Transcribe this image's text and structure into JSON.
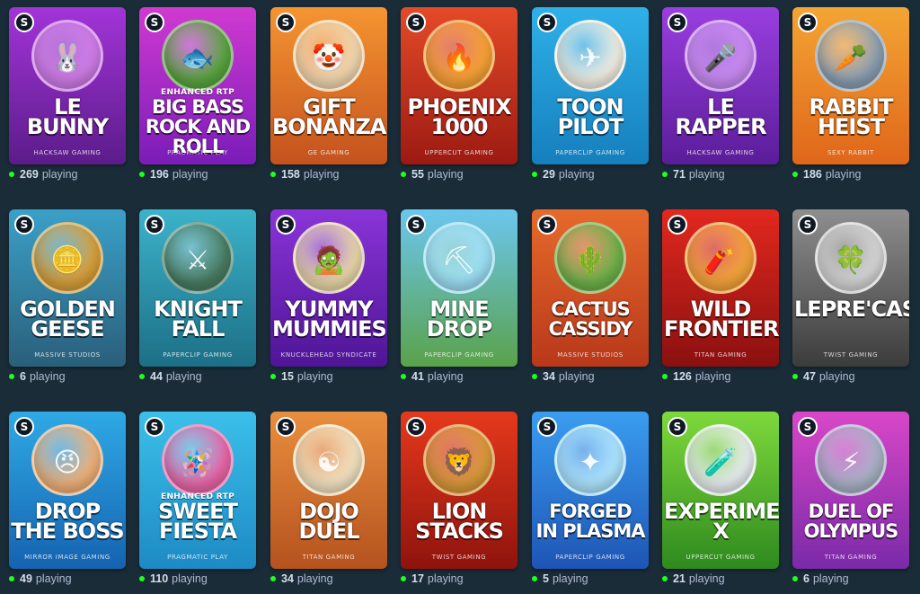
{
  "playing_label": "playing",
  "colors": {
    "background": "#1a2c38",
    "online_dot": "#1fff20"
  },
  "games": [
    {
      "title": "LE\nBUNNY",
      "subtitle": "",
      "provider": "HACKSAW GAMING",
      "players": "269",
      "bg": [
        "#a234d8",
        "#5b1c8a"
      ],
      "art": "#d07de8",
      "icon": "bunny-icon",
      "glyph": "🐰"
    },
    {
      "title": "BIG BASS\nROCK AND ROLL",
      "subtitle": "ENHANCED RTP",
      "provider": "PRAGMATIC PLAY",
      "players": "196",
      "bg": [
        "#d03ad1",
        "#7a1cb8"
      ],
      "art": "#5aa640",
      "icon": "fish-icon",
      "glyph": "🐟"
    },
    {
      "title": "GIFT\nBONANZA",
      "subtitle": "",
      "provider": "GE GAMING",
      "players": "158",
      "bg": [
        "#f59531",
        "#c4521e"
      ],
      "art": "#f2d8b0",
      "icon": "clown-icon",
      "glyph": "🤡"
    },
    {
      "title": "PHOENIX\n1000",
      "subtitle": "",
      "provider": "UPPERCUT GAMING",
      "players": "55",
      "bg": [
        "#e44a28",
        "#9c1a12"
      ],
      "art": "#f7a236",
      "icon": "phoenix-icon",
      "glyph": "🔥"
    },
    {
      "title": "TOON\nPILOT",
      "subtitle": "",
      "provider": "PAPERCLIP GAMING",
      "players": "29",
      "bg": [
        "#2fb0e8",
        "#157fbd"
      ],
      "art": "#f2eee2",
      "icon": "pilot-icon",
      "glyph": "✈"
    },
    {
      "title": "LE\nRAPPER",
      "subtitle": "",
      "provider": "HACKSAW GAMING",
      "players": "71",
      "bg": [
        "#9a3ee0",
        "#5a1d99"
      ],
      "art": "#c98bf2",
      "icon": "microphone-icon",
      "glyph": "🎤"
    },
    {
      "title": "RABBIT\nHEIST",
      "subtitle": "",
      "provider": "SEXY RABBIT",
      "players": "186",
      "bg": [
        "#f3a534",
        "#e0661a"
      ],
      "art": "#8aa0b3",
      "icon": "rabbit-icon",
      "glyph": "🥕"
    },
    {
      "title": "GOLDEN\nGEESE",
      "subtitle": "",
      "provider": "MASSIVE STUDIOS",
      "players": "6",
      "bg": [
        "#3aa0c8",
        "#2a5f7a"
      ],
      "art": "#d9a03a",
      "icon": "coins-icon",
      "glyph": "🪙"
    },
    {
      "title": "KNIGHT\nFALL",
      "subtitle": "",
      "provider": "PAPERCLIP GAMING",
      "players": "44",
      "bg": [
        "#3bb3ca",
        "#1c6f86"
      ],
      "art": "#4a7d63",
      "icon": "knight-icon",
      "glyph": "⚔"
    },
    {
      "title": "YUMMY\nMUMMIES",
      "subtitle": "",
      "provider": "KNUCKLEHEAD SYNDICATE",
      "players": "15",
      "bg": [
        "#8a34d8",
        "#4e1596"
      ],
      "art": "#e9d8a8",
      "icon": "mummy-icon",
      "glyph": "🧟"
    },
    {
      "title": "MINE\nDROP",
      "subtitle": "",
      "provider": "PAPERCLIP GAMING",
      "players": "41",
      "bg": [
        "#6bc6ee",
        "#5aa24a"
      ],
      "art": "#9de0f6",
      "icon": "pickaxe-icon",
      "glyph": "⛏"
    },
    {
      "title": "CACTUS\nCASSIDY",
      "subtitle": "",
      "provider": "MASSIVE STUDIOS",
      "players": "34",
      "bg": [
        "#e66a2c",
        "#b8381a"
      ],
      "art": "#6fb24a",
      "icon": "cactus-icon",
      "glyph": "🌵"
    },
    {
      "title": "WILD\nFRONTIER",
      "subtitle": "",
      "provider": "TITAN GAMING",
      "players": "126",
      "bg": [
        "#e2281e",
        "#8a1010"
      ],
      "art": "#f5a53a",
      "icon": "dynamite-icon",
      "glyph": "🧨"
    },
    {
      "title": "LEPRE'CASH",
      "subtitle": "",
      "provider": "TWIST GAMING",
      "players": "47",
      "bg": [
        "#8e8e8e",
        "#3c3c3c"
      ],
      "art": "#d6d6d6",
      "icon": "leprechaun-icon",
      "glyph": "🍀"
    },
    {
      "title": "DROP\nTHE BOSS",
      "subtitle": "",
      "provider": "MIRROR IMAGE GAMING",
      "players": "49",
      "bg": [
        "#2fa9e6",
        "#1563b0"
      ],
      "art": "#f0b179",
      "icon": "boss-icon",
      "glyph": "😠"
    },
    {
      "title": "SWEET\nFIESTA",
      "subtitle": "ENHANCED RTP",
      "provider": "PRAGMATIC PLAY",
      "players": "110",
      "bg": [
        "#3bc0ea",
        "#1d8ac4"
      ],
      "art": "#e967a8",
      "icon": "pinata-icon",
      "glyph": "🪅"
    },
    {
      "title": "DOJO\nDUEL",
      "subtitle": "",
      "provider": "TITAN GAMING",
      "players": "34",
      "bg": [
        "#e98e3e",
        "#b5521e"
      ],
      "art": "#f2e3c2",
      "icon": "yin-yang-icon",
      "glyph": "☯"
    },
    {
      "title": "LION\nSTACKS",
      "subtitle": "",
      "provider": "TWIST GAMING",
      "players": "17",
      "bg": [
        "#e6391c",
        "#8f130d"
      ],
      "art": "#d99a3a",
      "icon": "lion-icon",
      "glyph": "🦁"
    },
    {
      "title": "FORGED\nIN PLASMA",
      "subtitle": "",
      "provider": "PAPERCLIP GAMING",
      "players": "5",
      "bg": [
        "#3a9df0",
        "#1e55b5"
      ],
      "art": "#aee6ff",
      "icon": "plasma-icon",
      "glyph": "✦"
    },
    {
      "title": "EXPERIMENT X",
      "subtitle": "",
      "provider": "UPPERCUT GAMING",
      "players": "21",
      "bg": [
        "#7ed93c",
        "#2e8a1e"
      ],
      "art": "#e9edf0",
      "icon": "scientist-icon",
      "glyph": "🧪"
    },
    {
      "title": "DUEL OF\nOLYMPUS",
      "subtitle": "",
      "provider": "TITAN GAMING",
      "players": "6",
      "bg": [
        "#d847c8",
        "#7a2aa8"
      ],
      "art": "#a9b3c6",
      "icon": "zeus-icon",
      "glyph": "⚡"
    }
  ]
}
